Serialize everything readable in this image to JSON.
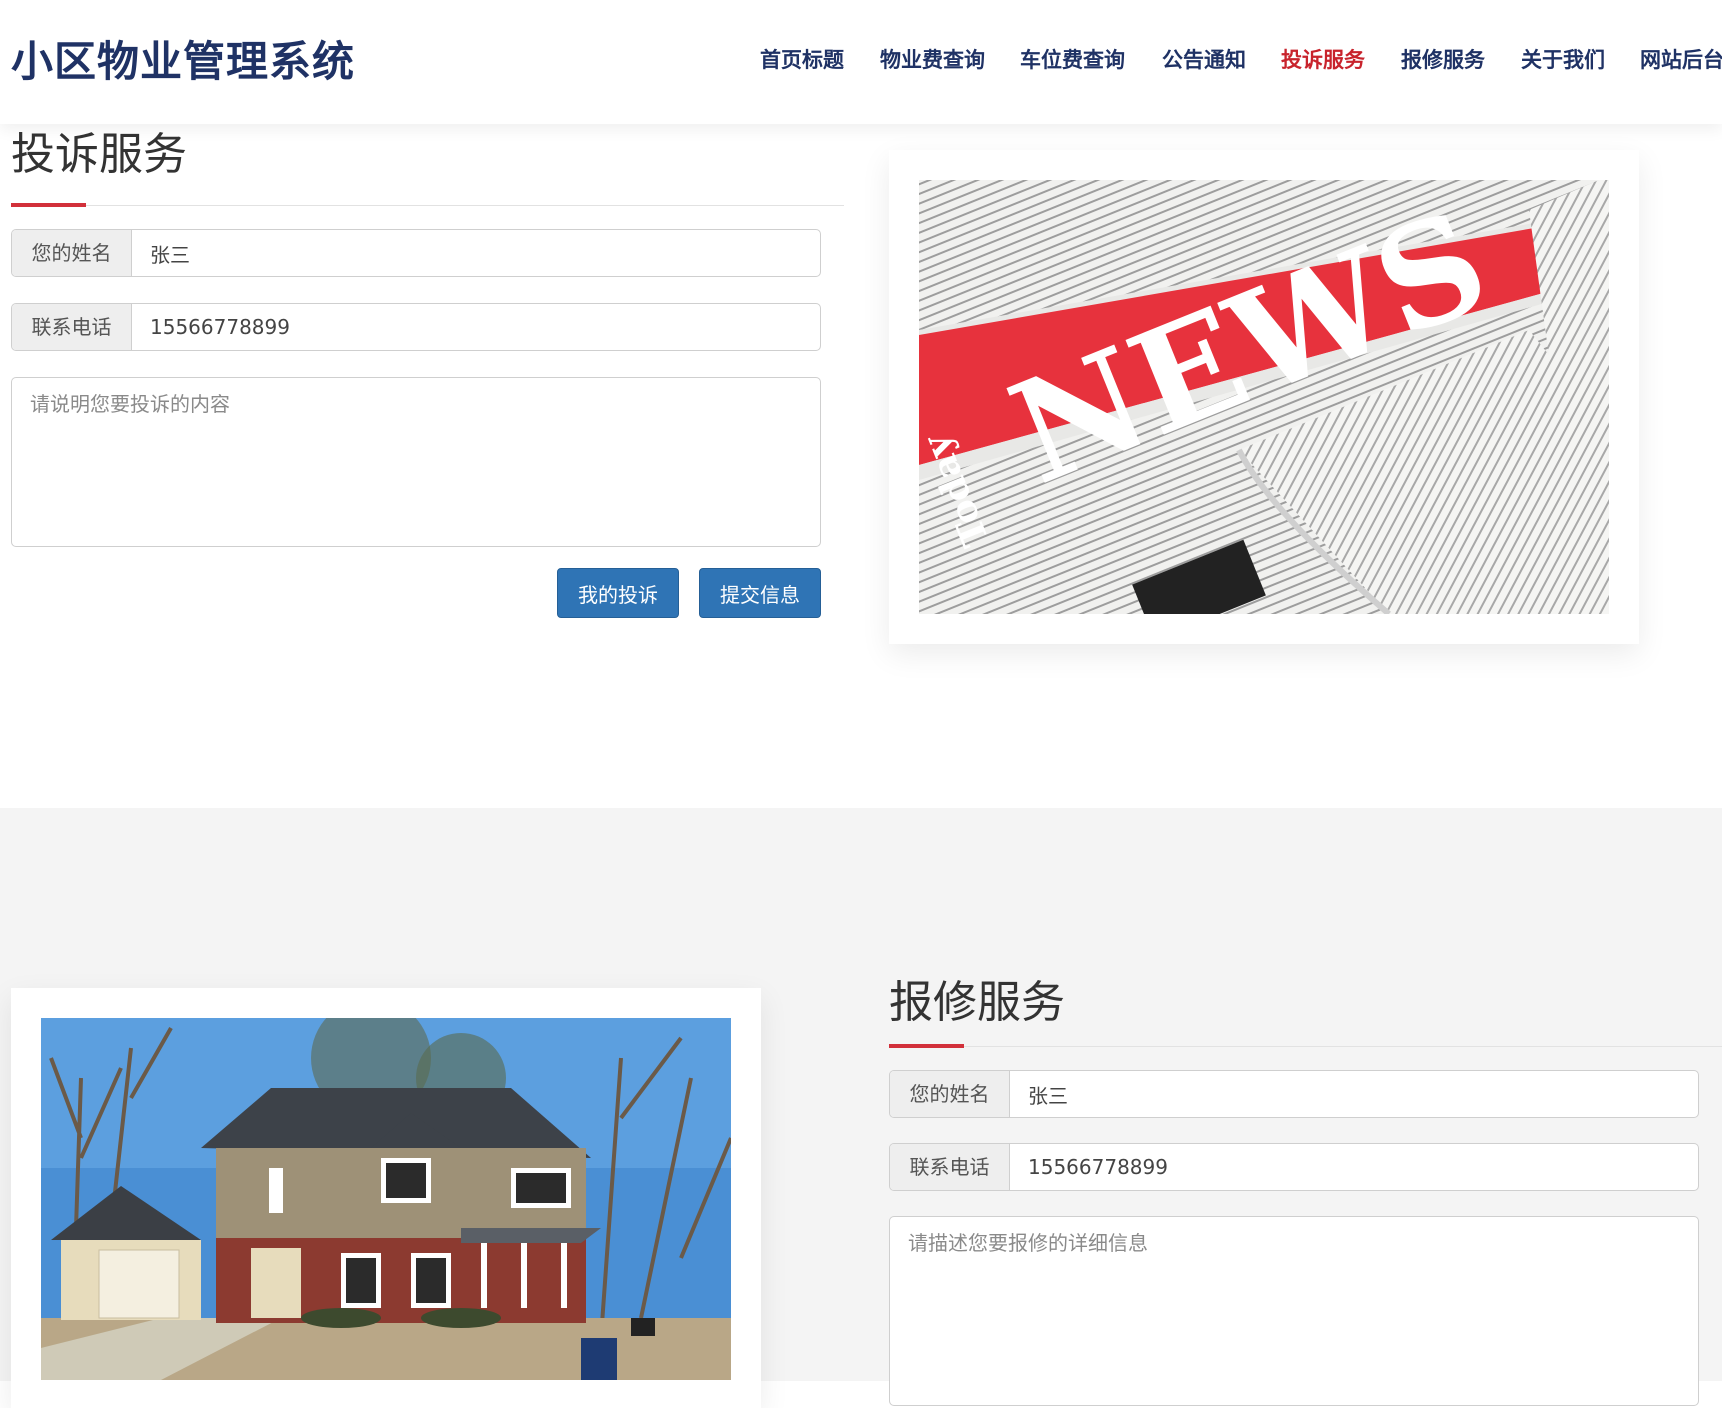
{
  "header": {
    "brand": "小区物业管理系统",
    "nav": [
      {
        "label": "首页标题",
        "active": false
      },
      {
        "label": "物业费查询",
        "active": false
      },
      {
        "label": "车位费查询",
        "active": false
      },
      {
        "label": "公告通知",
        "active": false
      },
      {
        "label": "投诉服务",
        "active": true
      },
      {
        "label": "报修服务",
        "active": false
      },
      {
        "label": "关于我们",
        "active": false
      },
      {
        "label": "网站后台",
        "active": false
      }
    ]
  },
  "complaint": {
    "title": "投诉服务",
    "name_label": "您的姓名",
    "name_value": "张三",
    "phone_label": "联系电话",
    "phone_value": "15566778899",
    "content_placeholder": "请说明您要投诉的内容",
    "my_complaints_button": "我的投诉",
    "submit_button": "提交信息",
    "image": {
      "headline": "NEWS",
      "word": "Today"
    }
  },
  "repair": {
    "title": "报修服务",
    "name_label": "您的姓名",
    "name_value": "张三",
    "phone_label": "联系电话",
    "phone_value": "15566778899",
    "content_placeholder": "请描述您要报修的详细信息"
  },
  "colors": {
    "brand": "#1f3265",
    "active_nav": "#c8232c",
    "accent": "#d2303a",
    "button": "#2f74b5"
  }
}
